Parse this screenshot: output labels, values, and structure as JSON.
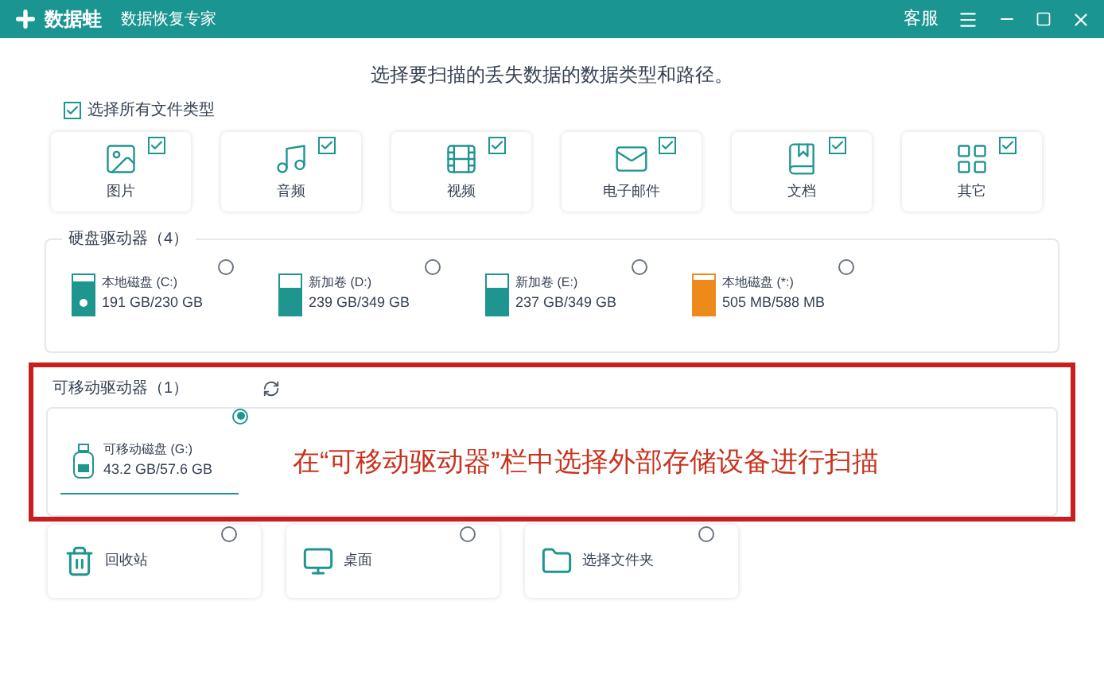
{
  "app": {
    "name": "数据蛙",
    "subtitle": "数据恢复专家",
    "service": "客服"
  },
  "heading": "选择要扫描的丢失数据的数据类型和路径。",
  "select_all": {
    "label": "选择所有文件类型",
    "checked": true
  },
  "file_types": [
    {
      "kind": "image",
      "label": "图片",
      "checked": true
    },
    {
      "kind": "audio",
      "label": "音频",
      "checked": true
    },
    {
      "kind": "video",
      "label": "视频",
      "checked": true
    },
    {
      "kind": "mail",
      "label": "电子邮件",
      "checked": true
    },
    {
      "kind": "document",
      "label": "文档",
      "checked": true
    },
    {
      "kind": "other",
      "label": "其它",
      "checked": true
    }
  ],
  "hard_drives": {
    "title": "硬盘驱动器（4）",
    "drives": [
      {
        "name": "本地磁盘 (C:)",
        "size": "191 GB/230 GB",
        "level": 0.83,
        "color": "#1f9590",
        "system": true,
        "selected": false
      },
      {
        "name": "新加卷 (D:)",
        "size": "239 GB/349 GB",
        "level": 0.68,
        "color": "#1f9590",
        "system": false,
        "selected": false
      },
      {
        "name": "新加卷 (E:)",
        "size": "237 GB/349 GB",
        "level": 0.68,
        "color": "#1f9590",
        "system": false,
        "selected": false
      },
      {
        "name": "本地磁盘 (*:)",
        "size": "505 MB/588 MB",
        "level": 0.86,
        "color": "#ee8a1c",
        "system": false,
        "selected": false
      }
    ]
  },
  "removable": {
    "title": "可移动驱动器（1）",
    "drives": [
      {
        "name": "可移动磁盘 (G:)",
        "size": "43.2 GB/57.6 GB",
        "selected": true
      }
    ]
  },
  "annotation": "在“可移动驱动器”栏中选择外部存储设备进行扫描",
  "locations": [
    {
      "kind": "recycle",
      "label": "回收站",
      "selected": false
    },
    {
      "kind": "desktop",
      "label": "桌面",
      "selected": false
    },
    {
      "kind": "folder",
      "label": "选择文件夹",
      "selected": false
    }
  ]
}
